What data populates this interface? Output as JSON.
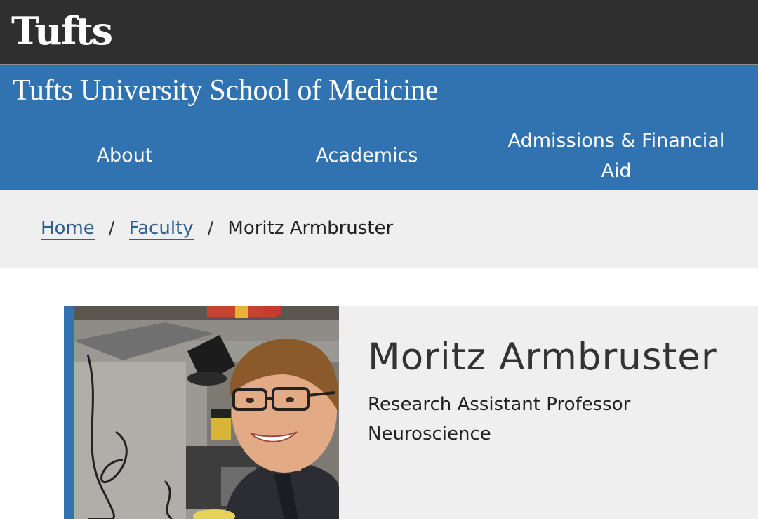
{
  "header": {
    "logo": "Tufts",
    "site_name": "Tufts University School of Medicine"
  },
  "nav": {
    "items": [
      {
        "label": "About"
      },
      {
        "label": "Academics"
      },
      {
        "label": "Admissions & Financial Aid"
      }
    ]
  },
  "breadcrumb": {
    "home": "Home",
    "faculty": "Faculty",
    "separator": "/",
    "current": "Moritz Armbruster"
  },
  "profile": {
    "name": "Moritz Armbruster",
    "title": "Research Assistant Professor",
    "department": "Neuroscience",
    "photo": "faculty-portrait"
  },
  "colors": {
    "topbar": "#2f2f2f",
    "brand_blue": "#3172b0",
    "light_gray": "#efefef"
  }
}
